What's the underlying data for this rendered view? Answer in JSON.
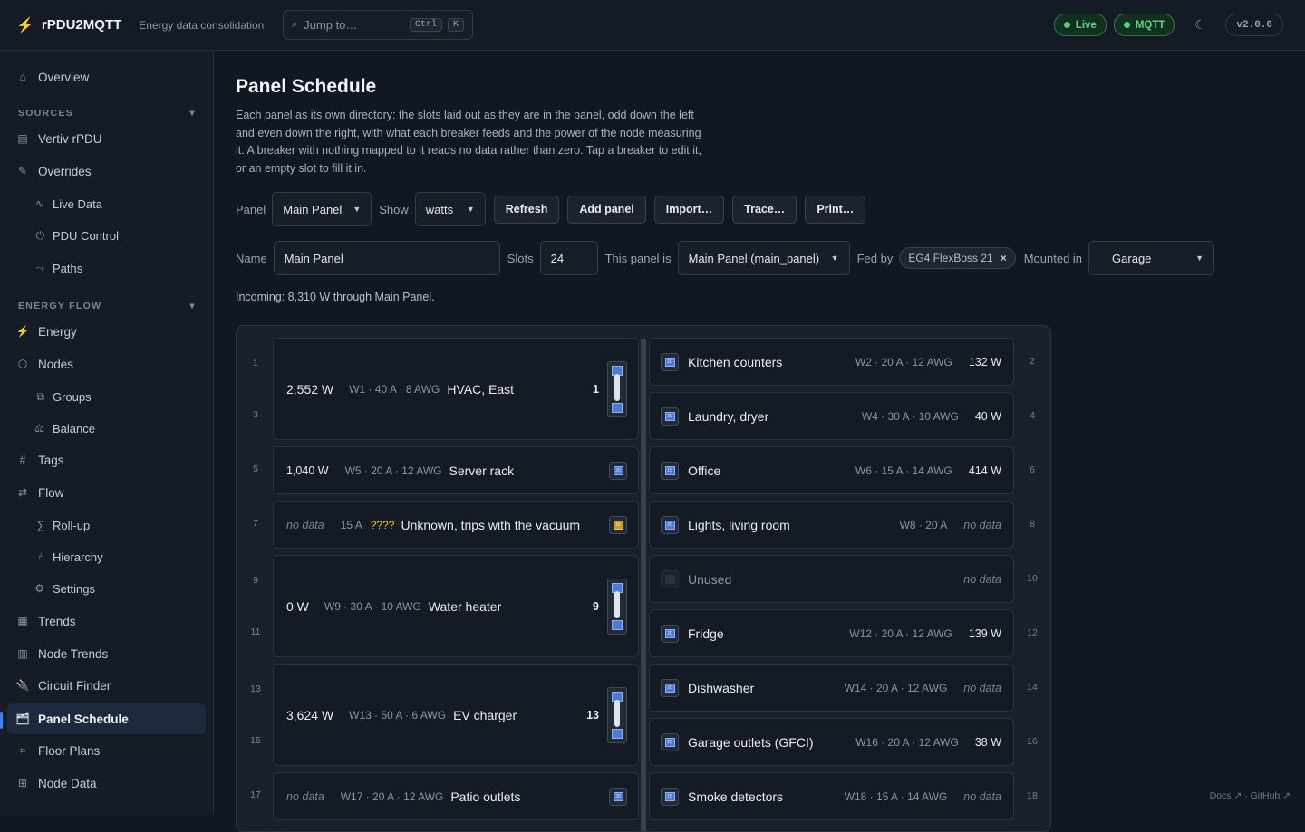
{
  "app": {
    "name": "rPDU2MQTT",
    "subtitle": "Energy data consolidation",
    "search_placeholder": "Jump to…",
    "kbd1": "Ctrl",
    "kbd2": "K",
    "status_live": "Live",
    "status_mqtt": "MQTT",
    "version": "v2.0.0"
  },
  "sidebar": {
    "overview": "Overview",
    "sources_title": "SOURCES",
    "sources": [
      "Vertiv rPDU",
      "Overrides",
      "Live Data",
      "PDU Control",
      "Paths"
    ],
    "energy_title": "ENERGY FLOW",
    "energy": [
      "Energy",
      "Nodes",
      "Groups",
      "Balance",
      "Tags",
      "Flow",
      "Roll-up",
      "Hierarchy",
      "Settings",
      "Trends",
      "Node Trends",
      "Circuit Finder",
      "Panel Schedule",
      "Floor Plans",
      "Node Data"
    ]
  },
  "page": {
    "title": "Panel Schedule",
    "description": "Each panel as its own directory: the slots laid out as they are in the panel, odd down the left and even down the right, with what each breaker feeds and the power of the node measuring it. A breaker with nothing mapped to it reads no data rather than zero. Tap a breaker to edit it, or an empty slot to fill it in.",
    "panel_label": "Panel",
    "panel_value": "Main Panel",
    "show_label": "Show",
    "show_value": "watts",
    "buttons": [
      "Refresh",
      "Add panel",
      "Import…",
      "Trace…",
      "Print…"
    ],
    "name_label": "Name",
    "name_value": "Main Panel",
    "slots_label": "Slots",
    "slots_value": "24",
    "this_panel_label": "This panel is",
    "this_panel_value": "Main Panel (main_panel)",
    "fed_label": "Fed by",
    "fed_value": "EG4 FlexBoss 21",
    "mounted_label": "Mounted in",
    "mounted_value": "Garage",
    "incoming": "Incoming: 8,310 W through Main Panel."
  },
  "slot_numbers": [
    "1",
    "2",
    "3",
    "4",
    "5",
    "6",
    "7",
    "8",
    "9",
    "10",
    "11",
    "12",
    "13",
    "14",
    "15",
    "16",
    "17",
    "18"
  ],
  "left": [
    {
      "watts": "2,552 W",
      "meta": "W1 · 40 A · 8 AWG",
      "name": "HVAC, East",
      "slot": "1"
    },
    {
      "watts": "1,040 W",
      "meta": "W5 · 20 A · 12 AWG",
      "name": "Server rack",
      "badge": "20"
    },
    {
      "watts": "no data",
      "meta": "15 A",
      "q": "????",
      "name": "Unknown, trips with the vacuum",
      "badge": "15"
    },
    {
      "watts": "0 W",
      "meta": "W9 · 30 A · 10 AWG",
      "name": "Water heater",
      "slot": "9"
    },
    {
      "watts": "3,624 W",
      "meta": "W13 · 50 A · 6 AWG",
      "name": "EV charger",
      "slot": "13"
    },
    {
      "watts": "no data",
      "meta": "W17 · 20 A · 12 AWG",
      "name": "Patio outlets",
      "badge": "20"
    }
  ],
  "right": [
    {
      "badge": "20",
      "name": "Kitchen counters",
      "meta": "W2 · 20 A · 12 AWG",
      "watts": "132 W"
    },
    {
      "badge": "30",
      "name": "Laundry, dryer",
      "meta": "W4 · 30 A · 10 AWG",
      "watts": "40 W"
    },
    {
      "badge": "15",
      "name": "Office",
      "meta": "W6 · 15 A · 14 AWG",
      "watts": "414 W"
    },
    {
      "badge": "20",
      "name": "Lights, living room",
      "meta": "W8 · 20 A",
      "watts": "no data"
    },
    {
      "name": "Unused",
      "meta": "",
      "watts": "no data"
    },
    {
      "badge": "20",
      "name": "Fridge",
      "meta": "W12 · 20 A · 12 AWG",
      "watts": "139 W"
    },
    {
      "badge": "20",
      "name": "Dishwasher",
      "meta": "W14 · 20 A · 12 AWG",
      "watts": "no data"
    },
    {
      "badge": "20",
      "name": "Garage outlets (GFCI)",
      "meta": "W16 · 20 A · 12 AWG",
      "watts": "38 W"
    },
    {
      "badge": "15",
      "name": "Smoke detectors",
      "meta": "W18 · 15 A · 14 AWG",
      "watts": "no data"
    }
  ],
  "footer": "Docs ↗ · GitHub ↗"
}
